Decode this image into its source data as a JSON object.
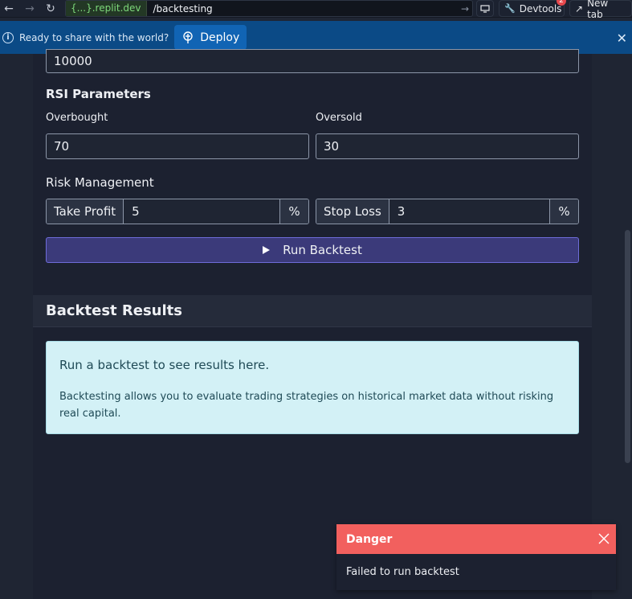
{
  "browser": {
    "url_host": "{...}.replit.dev",
    "url_path": "/backtesting",
    "devtools_label": "Devtools",
    "devtools_badge": "2",
    "newtab_label": "New tab"
  },
  "banner": {
    "text": "Ready to share with the world?",
    "deploy_label": "Deploy"
  },
  "form": {
    "initial_capital_value": "10000",
    "rsi_title": "RSI Parameters",
    "overbought_label": "Overbought",
    "overbought_value": "70",
    "oversold_label": "Oversold",
    "oversold_value": "30",
    "risk_title": "Risk Management",
    "take_profit_label": "Take Profit",
    "take_profit_value": "5",
    "take_profit_unit": "%",
    "stop_loss_label": "Stop Loss",
    "stop_loss_value": "3",
    "stop_loss_unit": "%",
    "run_label": "Run Backtest"
  },
  "results": {
    "title": "Backtest Results",
    "info_heading": "Run a backtest to see results here.",
    "info_body": "Backtesting allows you to evaluate trading strategies on historical market data without risking real capital."
  },
  "toast": {
    "title": "Danger",
    "message": "Failed to run backtest"
  }
}
